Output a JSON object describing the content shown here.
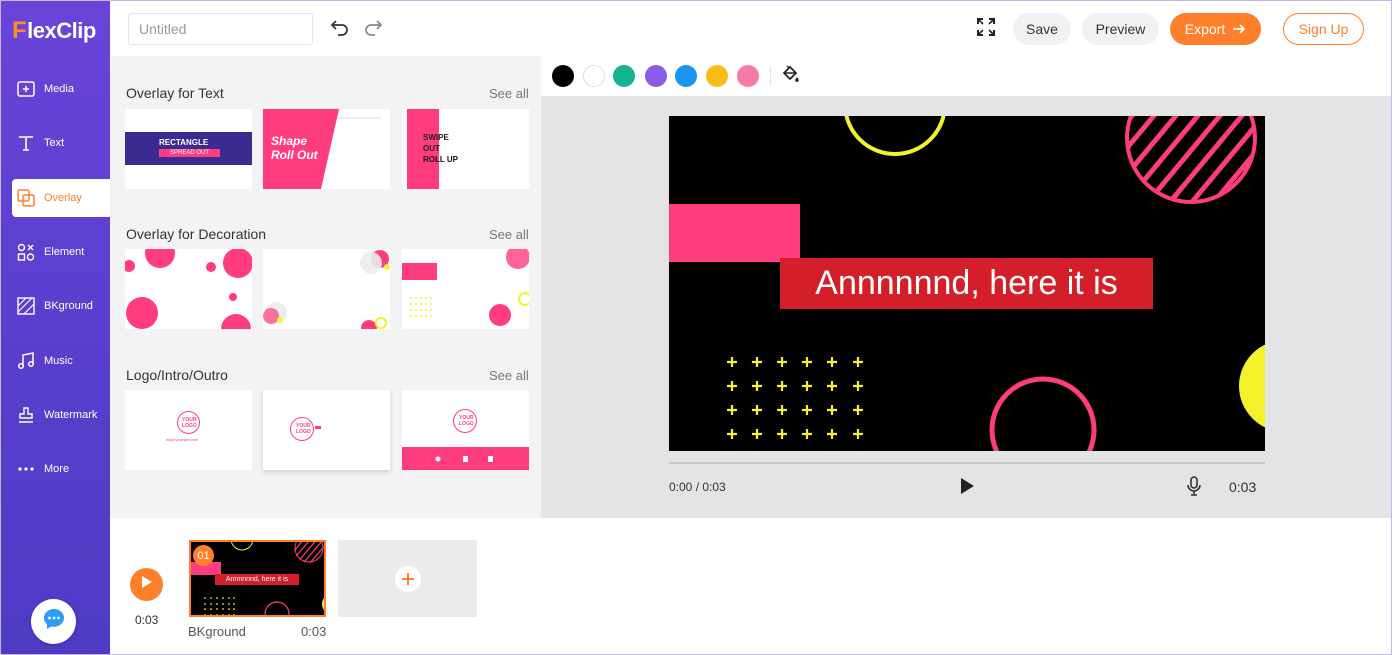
{
  "app": {
    "logo_mark": "F",
    "logo_rest": "lexClip"
  },
  "sidebar": {
    "items": [
      {
        "label": "Media",
        "icon": "media-icon"
      },
      {
        "label": "Text",
        "icon": "text-icon"
      },
      {
        "label": "Overlay",
        "icon": "overlay-icon",
        "active": true
      },
      {
        "label": "Element",
        "icon": "element-icon"
      },
      {
        "label": "BKground",
        "icon": "background-icon"
      },
      {
        "label": "Music",
        "icon": "music-icon"
      },
      {
        "label": "Watermark",
        "icon": "watermark-icon"
      },
      {
        "label": "More",
        "icon": "more-icon"
      }
    ]
  },
  "topbar": {
    "title_placeholder": "Untitled",
    "save_label": "Save",
    "preview_label": "Preview",
    "export_label": "Export",
    "signup_label": "Sign Up"
  },
  "panel": {
    "sections": [
      {
        "title": "Overlay for Text",
        "see_all": "See all"
      },
      {
        "title": "Overlay for Decoration",
        "see_all": "See all"
      },
      {
        "title": "Logo/Intro/Outro",
        "see_all": "See all"
      }
    ],
    "text_thumbs": {
      "t1_line1": "RECTANGLE",
      "t1_line2": "SPREAD OUT",
      "t2_line1": "Shape",
      "t2_line2": "Roll Out",
      "t3_line1": "SWIPE",
      "t3_line2": "OUT",
      "t3_line3": "ROLL UP"
    },
    "logo_thumbs": {
      "your_logo_1": "YOUR",
      "your_logo_2": "LOGO",
      "site": "www.yoursite.com"
    }
  },
  "colorbar": {
    "swatches": [
      "#000000",
      "#ffffff",
      "#14b38f",
      "#8a5de6",
      "#1a96f0",
      "#fbbd15",
      "#f77aa6"
    ]
  },
  "stage": {
    "caption": "Annnnnnd, here it is",
    "time_current": "0:00 / 0:03",
    "duration": "0:03",
    "colors": {
      "pink": "#ff3c7f",
      "yellow": "#f4f22c",
      "red": "#d21f2a"
    }
  },
  "timeline": {
    "total_time": "0:03",
    "clip_badge": "01",
    "clip_caption": "Annnnnnd, here it is",
    "clip_label": "BKground",
    "clip_duration": "0:03"
  },
  "accent": "#ff7f2a",
  "sidebar_color": "#5b3fcf"
}
